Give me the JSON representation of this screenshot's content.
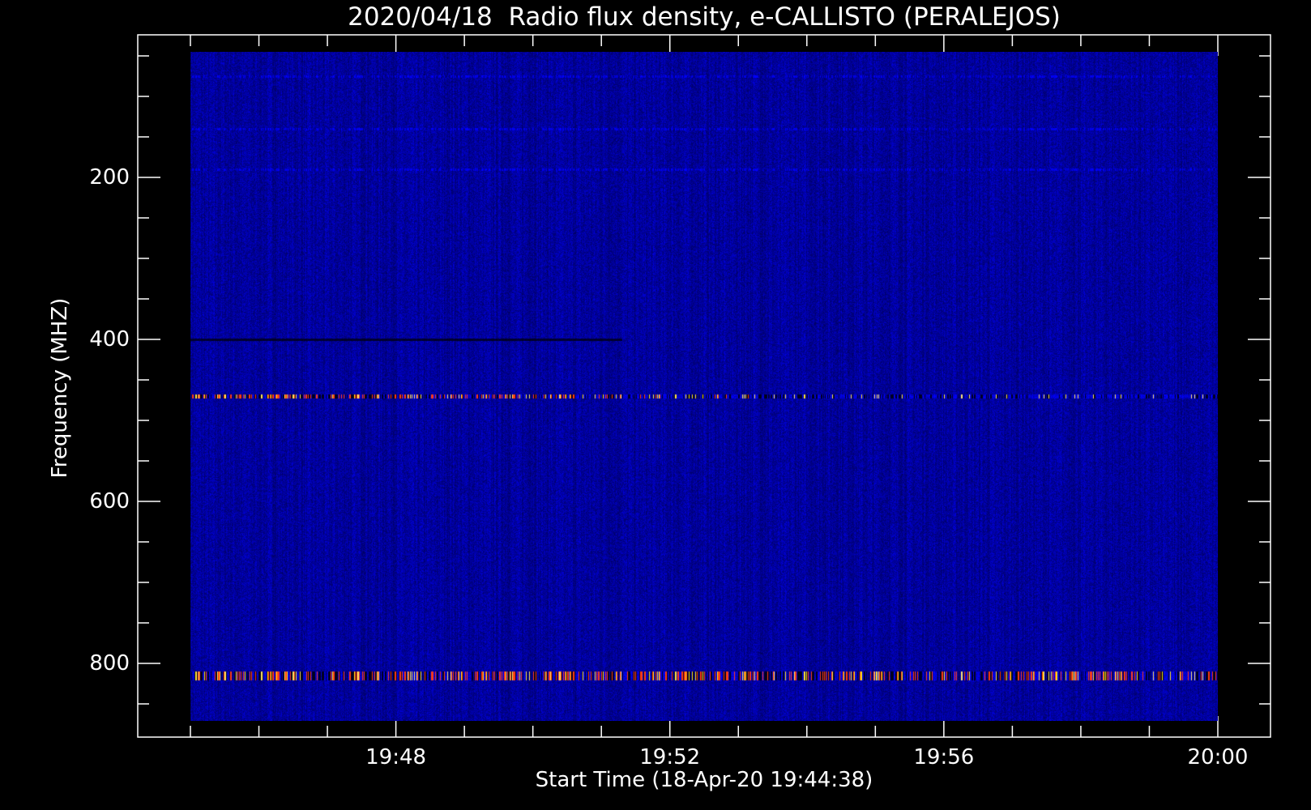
{
  "chart_data": {
    "type": "heatmap",
    "title": "2020/04/18  Radio flux density, e-CALLISTO (PERALEJOS)",
    "xlabel": "Start Time (18-Apr-20 19:44:38)",
    "ylabel": "Frequency (MHZ)",
    "x_ticks": [
      "19:48",
      "19:52",
      "19:56",
      "20:00"
    ],
    "x_tick_minutes": [
      3,
      7,
      11,
      15
    ],
    "x_minor_tick_step_min": 1,
    "x_data_range_min": [
      0,
      15
    ],
    "y_ticks": [
      200,
      400,
      600,
      800
    ],
    "y_minor_tick_step": 50,
    "y_range": [
      24,
      891
    ],
    "y_data_range": [
      45,
      871
    ],
    "y_inverted": true,
    "colormap": [
      "#000000",
      "#1010a0",
      "#2a2aff",
      "#ff2000",
      "#ffff60"
    ],
    "background_level": "low (blue)",
    "features": [
      {
        "type": "bright-band",
        "freq_mhz": 470,
        "intensity": "high at start, fading"
      },
      {
        "type": "bright-band",
        "freq_mhz": 815,
        "intensity": "high, intermittent bursts"
      },
      {
        "type": "weak-band",
        "freq_mhz": 190,
        "intensity": "medium"
      },
      {
        "type": "weak-band",
        "freq_mhz": 140,
        "intensity": "medium"
      },
      {
        "type": "weak-band",
        "freq_mhz": 75,
        "intensity": "low"
      },
      {
        "type": "dark-line",
        "freq_mhz": 400,
        "end_minute": 6.3
      }
    ]
  }
}
